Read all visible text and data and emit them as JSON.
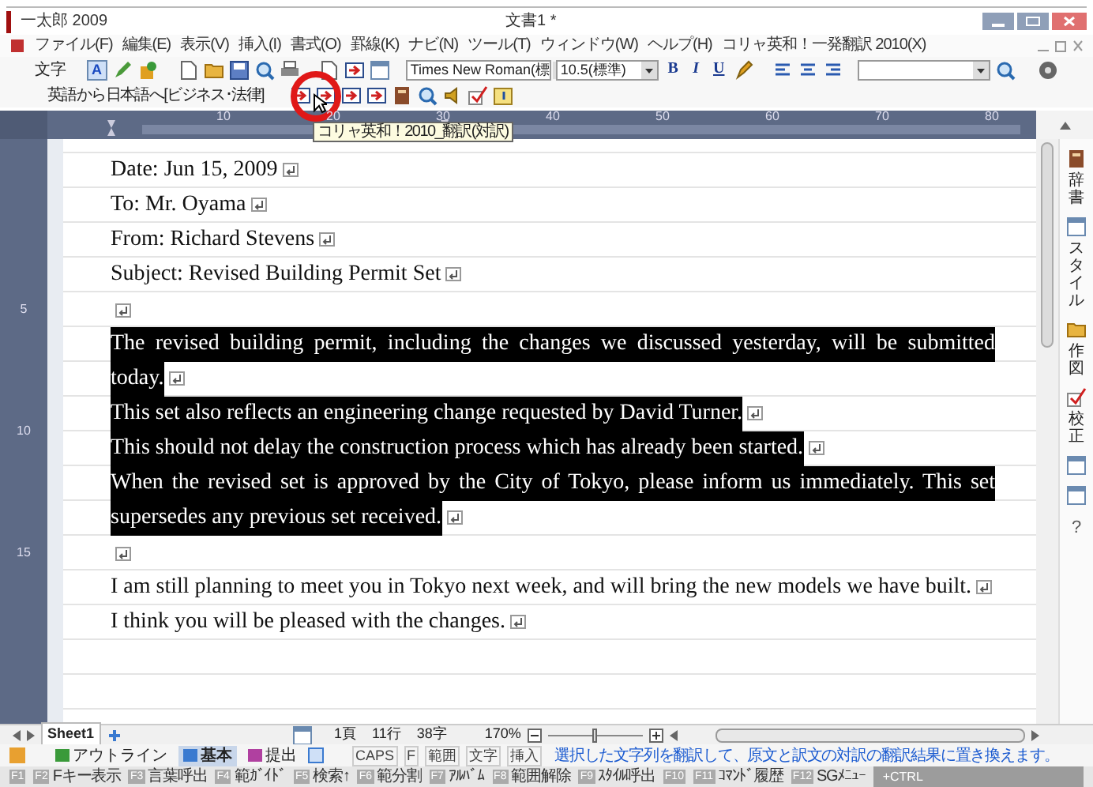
{
  "window": {
    "app_title": "一太郎 2009",
    "document_title": "文書1 *"
  },
  "menu": [
    "ファイル(F)",
    "編集(E)",
    "表示(V)",
    "挿入(I)",
    "書式(O)",
    "罫線(K)",
    "ナビ(N)",
    "ツール(T)",
    "ウィンドウ(W)",
    "ヘルプ(H)",
    "コリャ英和！一発翻訳 2010(X)"
  ],
  "toolbar": {
    "mode_label": "文字",
    "text_style_letter": "A",
    "font": "Times New Roman(標",
    "size": "10.5(標準)",
    "format_buttons": [
      "B",
      "I",
      "U"
    ]
  },
  "translate_bar": {
    "direction": "英語から日本語へ[ビジネス･法律]",
    "tooltip": "コリャ英和！2010_翻訳(対訳)"
  },
  "ruler": {
    "labels": [
      "10",
      "20",
      "30",
      "40",
      "50",
      "60",
      "70",
      "80"
    ],
    "side_labels": [
      "5",
      "10",
      "15"
    ]
  },
  "document": {
    "paragraphs": [
      {
        "lines": [
          "Date: Jun 15, 2009"
        ],
        "selected": false
      },
      {
        "lines": [
          "To: Mr. Oyama"
        ],
        "selected": false
      },
      {
        "lines": [
          "From: Richard Stevens"
        ],
        "selected": false
      },
      {
        "lines": [
          "Subject: Revised Building Permit Set"
        ],
        "selected": false
      },
      {
        "selected": false
      },
      {
        "lines": [
          "The revised building permit, including the changes we discussed yesterday, will be submitted",
          "today."
        ],
        "selected": true
      },
      {
        "lines": [
          "This set also reflects an engineering change requested by David Turner."
        ],
        "selected": true
      },
      {
        "lines": [
          "This should not delay the construction process which has already been started."
        ],
        "selected": true
      },
      {
        "lines": [
          "When the revised set is approved by the City of Tokyo, please inform us immediately. This set",
          "supersedes any previous set received."
        ],
        "selected": true
      },
      {
        "selected": false
      },
      {
        "lines": [
          "I am still planning to meet you in Tokyo next week, and will bring the new models we have built."
        ],
        "selected": false
      },
      {
        "lines": [
          "I think you will be pleased with the changes."
        ],
        "selected": false
      }
    ]
  },
  "sidebar": {
    "items": [
      {
        "kind": "tab",
        "label": "辞書"
      },
      {
        "kind": "tab",
        "label": "スタイル"
      },
      {
        "kind": "tab",
        "label": "作図"
      },
      {
        "kind": "tab",
        "label": "校正"
      },
      {
        "kind": "icon"
      },
      {
        "kind": "icon"
      },
      {
        "kind": "help",
        "label": "?"
      }
    ]
  },
  "sheet_bar": {
    "sheet": "Sheet1",
    "page": "1頁",
    "line": "11行",
    "chars": "38字",
    "zoom": "170%",
    "zoom_slider": {
      "level": 0.5
    }
  },
  "status": {
    "modes": [
      {
        "label": "アウトライン",
        "selected": false
      },
      {
        "label": "基本",
        "selected": true
      },
      {
        "label": "提出",
        "selected": false
      }
    ],
    "indicators": [
      "CAPS",
      "F",
      "範囲",
      "文字",
      "挿入"
    ],
    "message": "選択した文字列を翻訳して、原文と訳文の対訳の翻訳結果に置き換えます。"
  },
  "fkeys": [
    {
      "key": "F1"
    },
    {
      "key": "F2",
      "label": "Fキー表示"
    },
    {
      "key": "F3",
      "label": "言葉呼出"
    },
    {
      "key": "F4",
      "label": "範ｶﾞｲﾄﾞ"
    },
    {
      "key": "F5",
      "label": "検索↑"
    },
    {
      "key": "F6",
      "label": "範分割"
    },
    {
      "key": "F7",
      "label": "ｱﾙﾊﾞﾑ"
    },
    {
      "key": "F8",
      "label": "範囲解除"
    },
    {
      "key": "F9",
      "label": "ｽﾀｲﾙ呼出"
    },
    {
      "key": "F10"
    },
    {
      "key": "F11",
      "label": "ｺﾏﾝﾄﾞ履歴"
    },
    {
      "key": "F12",
      "label": "SGﾒﾆｭｰ"
    },
    {
      "key": "+CTRL"
    }
  ]
}
